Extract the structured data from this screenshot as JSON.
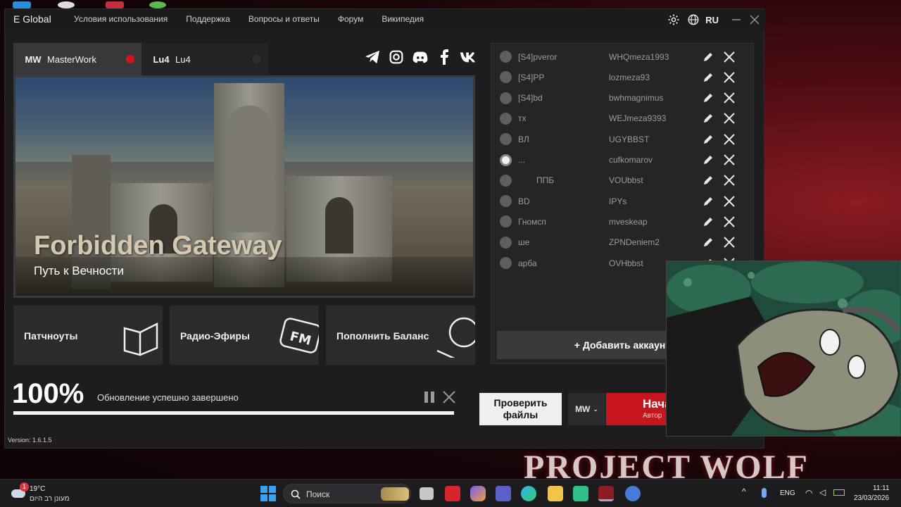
{
  "titlebar": {
    "app_title": "E Global",
    "nav": [
      "Условия использования",
      "Поддержка",
      "Вопросы и ответы",
      "Форум",
      "Википедия"
    ],
    "language": "RU"
  },
  "servers": [
    {
      "logo": "MW",
      "name": "MasterWork",
      "status_color": "#d4141c"
    },
    {
      "logo": "Lu4",
      "name": "Lu4",
      "status_color": "#2e2e30"
    }
  ],
  "socials": [
    "telegram-icon",
    "instagram-icon",
    "discord-icon",
    "facebook-icon",
    "vk-icon"
  ],
  "banner": {
    "title": "Forbidden Gateway",
    "subtitle": "Путь к Вечности"
  },
  "tiles": [
    {
      "label": "Патчноуты",
      "icon": "book-icon"
    },
    {
      "label": "Радио-Эфиры",
      "icon": "fm-radio-icon"
    },
    {
      "label": "Пополнить Баланс",
      "icon": "coin-icon"
    }
  ],
  "progress": {
    "percent_label": "100%",
    "value": 1.0,
    "status": "Обновление успешно завершено"
  },
  "version": "Version: 1.6.1.5",
  "accounts": {
    "rows": [
      {
        "name": "[S4]pveror",
        "login": "WHQmeza1993",
        "selected": false
      },
      {
        "name": "[S4]PP",
        "login": "lozmeza93",
        "selected": false
      },
      {
        "name": "[S4]bd",
        "login": "bwhmagnimus",
        "selected": false
      },
      {
        "name": "тх",
        "login": "WEJmeza9393",
        "selected": false
      },
      {
        "name": "ВЛ",
        "login": "UGYBBST",
        "selected": false
      },
      {
        "name": "...",
        "login": "cufkomarov",
        "selected": true
      },
      {
        "name": "ППБ",
        "login": "VOUbbst",
        "selected": false
      },
      {
        "name": "BD",
        "login": "IPYs",
        "selected": false
      },
      {
        "name": "Гномсп",
        "login": "mveskeap",
        "selected": false
      },
      {
        "name": "ше",
        "login": "ZPNDeniem2",
        "selected": false
      },
      {
        "name": "арба",
        "login": "OVHbbst",
        "selected": false
      }
    ],
    "add_label": "+ Добавить аккаунт"
  },
  "actions": {
    "check_files": "Проверить файлы",
    "server_select": "MW",
    "start_label": "Нача",
    "start_sub": "Автор"
  },
  "desktop": {
    "wallpaper_text": "PROJECT WOLF"
  },
  "taskbar": {
    "weather_temp": "19°C",
    "weather_desc": "מעונן רב היום",
    "weather_badge": "1",
    "search_placeholder": "Поиск",
    "tray_lang": "ENG",
    "time": "11:11",
    "date": "23/03/2026"
  },
  "colors": {
    "accent_red": "#c4161c",
    "panel": "#1d1d1f",
    "win_blue": "#3aa0f0"
  }
}
